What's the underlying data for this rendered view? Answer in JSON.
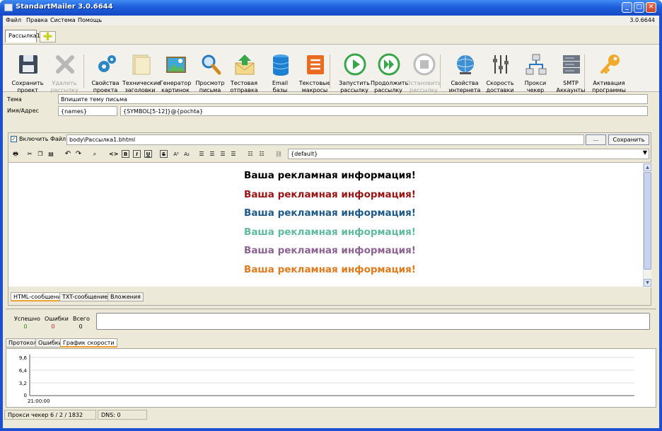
{
  "window": {
    "title": "StandartMailer 3.0.6644",
    "version": "3.0.6644"
  },
  "menu": [
    "Файл",
    "Правка",
    "Система",
    "Помощь"
  ],
  "doc_tab": "Рассылка1",
  "toolbar": [
    {
      "l1": "Сохранить",
      "l2": "проект",
      "icon": "save-icon"
    },
    {
      "l1": "Удалить",
      "l2": "рассылку",
      "icon": "delete-icon",
      "disabled": true
    },
    {
      "l1": "Свойства",
      "l2": "проекта",
      "icon": "gears-icon"
    },
    {
      "l1": "Технические",
      "l2": "заголовки",
      "icon": "headers-icon"
    },
    {
      "l1": "Генератор",
      "l2": "картинок",
      "icon": "image-generator-icon"
    },
    {
      "l1": "Просмотр",
      "l2": "письма",
      "icon": "magnifier-icon"
    },
    {
      "l1": "Тестовая",
      "l2": "отправка",
      "icon": "test-send-icon"
    },
    {
      "l1": "Email",
      "l2": "базы",
      "icon": "database-icon"
    },
    {
      "l1": "Текстовые",
      "l2": "макросы",
      "icon": "macros-icon"
    },
    {
      "l1": "Запустить",
      "l2": "рассылку",
      "icon": "play-icon"
    },
    {
      "l1": "Продолжить",
      "l2": "рассылку",
      "icon": "resume-icon"
    },
    {
      "l1": "Остановить",
      "l2": "рассылку",
      "icon": "stop-icon",
      "disabled": true
    },
    {
      "l1": "Свойства",
      "l2": "интернета",
      "icon": "globe-icon"
    },
    {
      "l1": "Скорость",
      "l2": "доставки",
      "icon": "speed-sliders-icon"
    },
    {
      "l1": "Прокси",
      "l2": "чекер",
      "icon": "proxy-network-icon"
    },
    {
      "l1": "SMTP",
      "l2": "Аккаунты",
      "icon": "smtp-server-icon"
    },
    {
      "l1": "Активация",
      "l2": "программы",
      "icon": "key-icon"
    }
  ],
  "fields": {
    "subject_label": "Тема",
    "subject_value": "Впишите тему письма",
    "name_label": "Имя/Адрес",
    "name_value": "{names}",
    "address_value": "{SYMBOL[5-12]}@{pochta}"
  },
  "editor": {
    "include_label": "Включить Файл :",
    "include_checked": true,
    "file_path": "body\\Рассылка1.bhtml",
    "browse_label": "...",
    "save_label": "Сохранить",
    "font_select": "{default}",
    "lines": [
      {
        "text": "Ваша рекламная информация!",
        "color": "#000000"
      },
      {
        "text": "Ваша рекламная информация!",
        "color": "#9b1414"
      },
      {
        "text": "Ваша рекламная информация!",
        "color": "#1d5a8a"
      },
      {
        "text": "Ваша рекламная информация!",
        "color": "#5dbb9a"
      },
      {
        "text": "Ваша рекламная информация!",
        "color": "#8c6392"
      },
      {
        "text": "Ваша рекламная информация!",
        "color": "#e07a1c"
      }
    ],
    "tabs": [
      "HTML-сообщение",
      "TXT-сообщение",
      "Вложения"
    ]
  },
  "stats": {
    "success_label": "Успешно",
    "success_value": "0",
    "errors_label": "Ошибки",
    "errors_value": "0",
    "total_label": "Всего",
    "total_value": "0"
  },
  "bottom_tabs": [
    "Протокол",
    "Ошибки",
    "График скорости"
  ],
  "graph": {
    "y_ticks": [
      "9,6",
      "6,4",
      "3,2",
      "0"
    ],
    "x_tick": "21:00:00"
  },
  "status": {
    "proxy": "Прокси чекер   6  /  2  /  1832",
    "dns": "DNS:   0"
  }
}
